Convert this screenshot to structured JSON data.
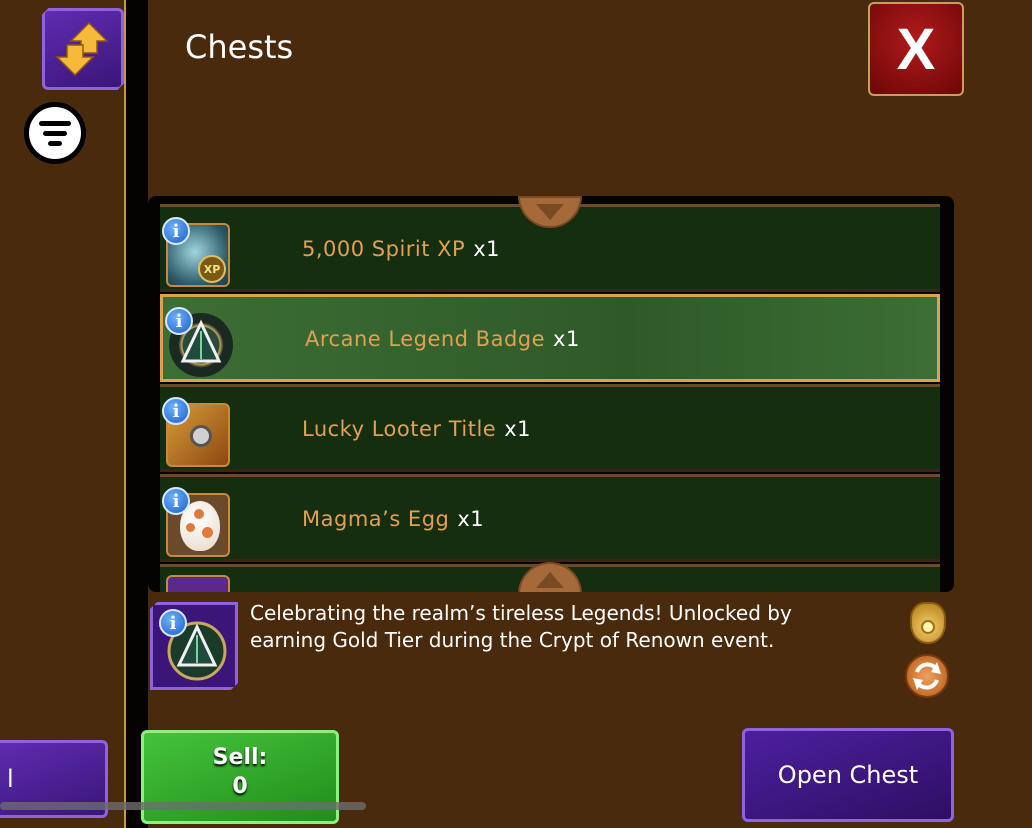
{
  "header": {
    "title": "Chests",
    "close_label": "X"
  },
  "items": [
    {
      "name": "5,000 Spirit XP",
      "qty": "x1",
      "icon": "spirit-xp-icon",
      "info_label": "i",
      "selected": false
    },
    {
      "name": "Arcane Legend Badge",
      "qty": "x1",
      "icon": "legend-badge-icon",
      "info_label": "i",
      "selected": true
    },
    {
      "name": "Lucky Looter Title",
      "qty": "x1",
      "icon": "title-scroll-icon",
      "info_label": "i",
      "selected": false
    },
    {
      "name": "Magma’s Egg",
      "qty": "x1",
      "icon": "egg-icon",
      "info_label": "i",
      "selected": false
    }
  ],
  "description": {
    "info_label": "i",
    "text": "Celebrating the realm’s tireless Legends! Unlocked by earning Gold Tier during the Crypt of Renown event."
  },
  "buttons": {
    "left_partial": "l",
    "sell_label": "Sell:",
    "sell_value": "0",
    "open_chest": "Open Chest"
  },
  "colors": {
    "background": "#4a2a0d",
    "row_bg": "#142e0f",
    "selected_row": "#3d6e35",
    "item_name": "#e0a055",
    "purple_button": "#3b1578",
    "green_button": "#1f8f1a",
    "close_red": "#8b0b0b"
  }
}
